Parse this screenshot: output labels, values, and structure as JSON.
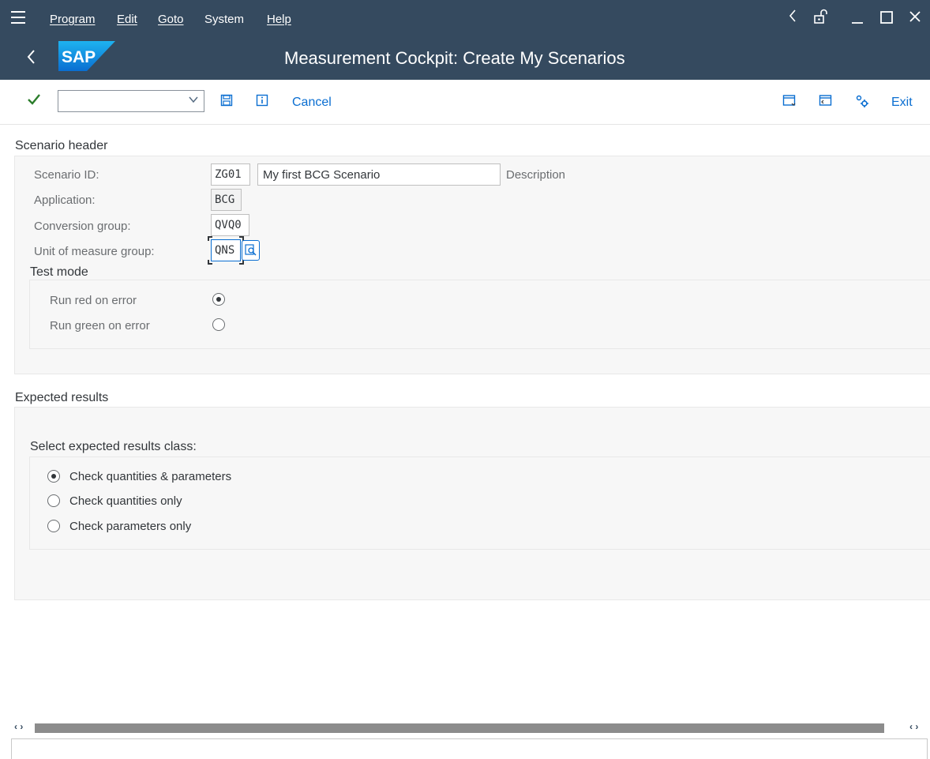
{
  "menu": {
    "items": [
      "Program",
      "Edit",
      "Goto",
      "System",
      "Help"
    ],
    "window_controls": {
      "back": "‹",
      "lock": "🔓",
      "minimize": "_",
      "maximize": "☐",
      "close": "✕"
    }
  },
  "title": {
    "logo_text": "SAP",
    "text": "Measurement Cockpit: Create My Scenarios"
  },
  "toolbar": {
    "command_value": "",
    "cancel_label": "Cancel",
    "exit_label": "Exit"
  },
  "scenario_header": {
    "title": "Scenario header",
    "scenario_id_label": "Scenario ID:",
    "scenario_id_value": "ZG01",
    "description_value": "My first BCG Scenario",
    "description_label": "Description",
    "application_label": "Application:",
    "application_value": "BCG",
    "conversion_group_label": "Conversion group:",
    "conversion_group_value": "QVQ0",
    "uom_group_label": "Unit of measure group:",
    "uom_group_value": "QNS"
  },
  "test_mode": {
    "title": "Test mode",
    "options": [
      {
        "label": "Run red on error",
        "checked": true
      },
      {
        "label": "Run green on error",
        "checked": false
      }
    ]
  },
  "expected_results": {
    "title": "Expected results",
    "subtitle": "Select expected results class:",
    "options": [
      {
        "label": "Check quantities & parameters",
        "checked": true
      },
      {
        "label": "Check quantities only",
        "checked": false
      },
      {
        "label": "Check parameters only",
        "checked": false
      }
    ]
  },
  "colors": {
    "shell": "#354a5f",
    "accent": "#0a6ed1",
    "ok_green": "#2b7d2b"
  }
}
